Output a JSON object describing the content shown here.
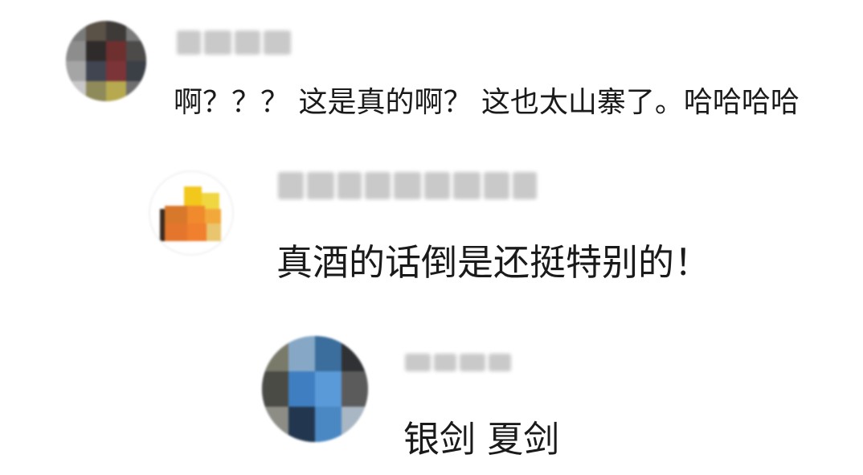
{
  "comments": [
    {
      "username": "",
      "text": "啊？？？ 这是真的啊？ 这也太山寨了。哈哈哈哈"
    },
    {
      "username": "",
      "text": "真酒的话倒是还挺特别的！"
    },
    {
      "username": "momo",
      "text": "银剑 夏剑"
    }
  ]
}
